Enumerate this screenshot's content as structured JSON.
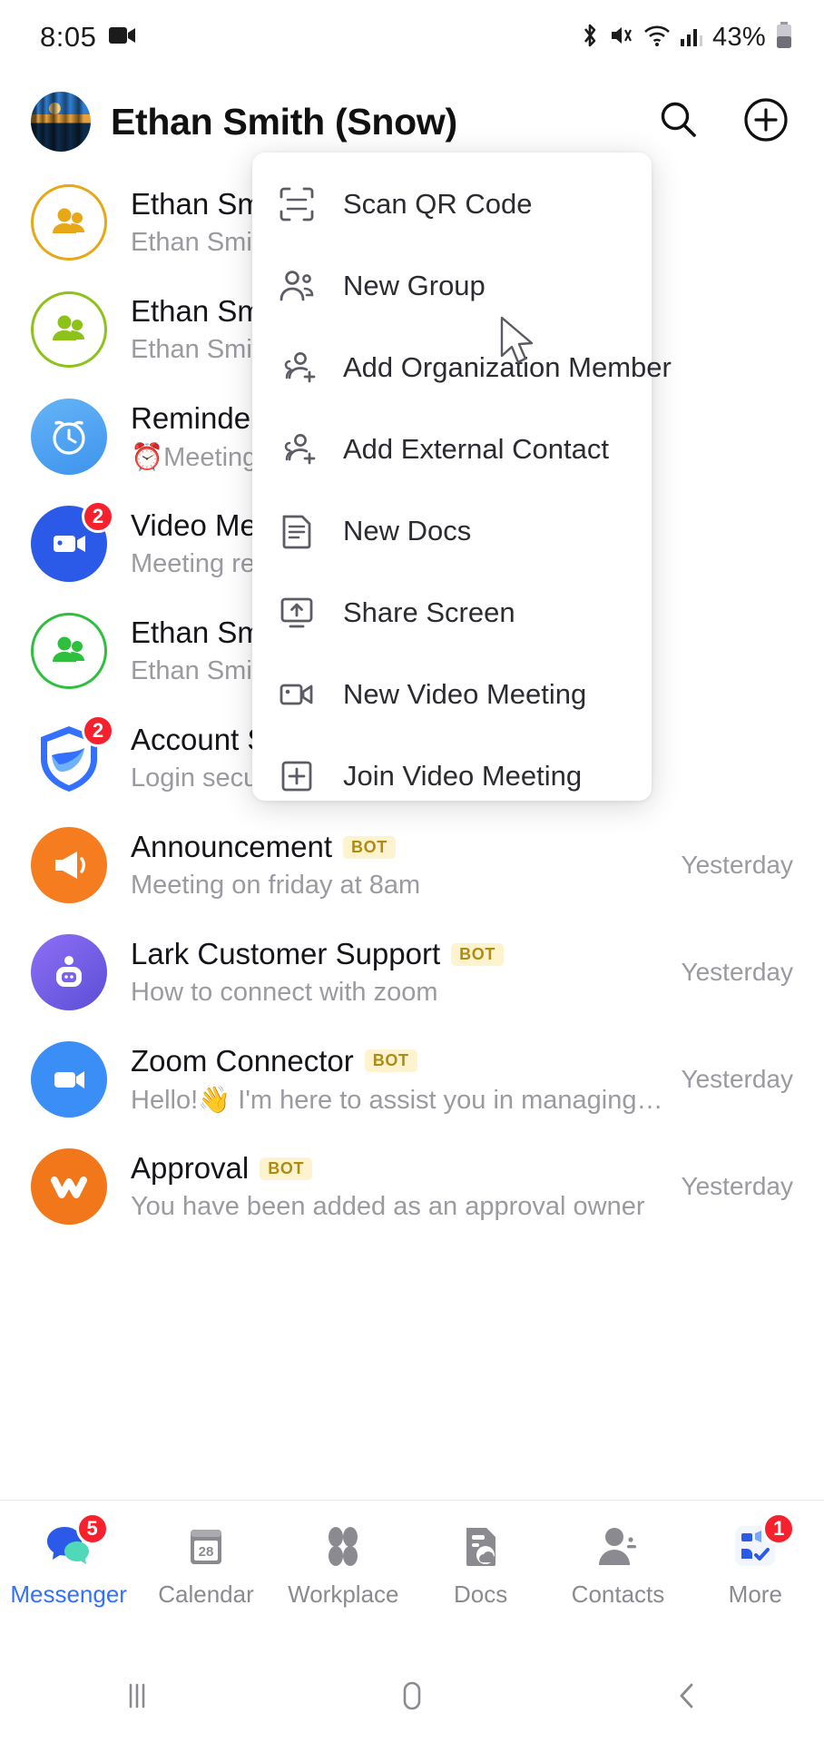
{
  "status_bar": {
    "time": "8:05",
    "battery_percent": "43%",
    "icons": [
      "video-recording-icon",
      "bluetooth-icon",
      "mute-icon",
      "wifi-icon",
      "cellular-signal-icon",
      "battery-icon"
    ]
  },
  "header": {
    "title": "Ethan Smith (Snow)",
    "avatar_name": "user-avatar",
    "search_label": "Search",
    "add_label": "Add"
  },
  "menu": {
    "items": [
      {
        "label": "Scan QR Code",
        "icon": "scan-qr-icon"
      },
      {
        "label": "New Group",
        "icon": "new-group-icon"
      },
      {
        "label": "Add Organization Member",
        "icon": "add-organization-member-icon"
      },
      {
        "label": "Add External Contact",
        "icon": "add-external-contact-icon"
      },
      {
        "label": "New Docs",
        "icon": "new-docs-icon"
      },
      {
        "label": "Share Screen",
        "icon": "share-screen-icon"
      },
      {
        "label": "New Video Meeting",
        "icon": "new-video-meeting-icon"
      },
      {
        "label": "Join Video Meeting",
        "icon": "join-video-meeting-icon"
      }
    ]
  },
  "chats": [
    {
      "title": "Ethan Smith",
      "subtitle": "Ethan Smith",
      "time": "",
      "bot": false,
      "badge": "",
      "avatar": "group-avatar-yellow",
      "avatar_style": "ring",
      "color": "#e6a817"
    },
    {
      "title": "Ethan Smith",
      "subtitle": "Ethan Smith",
      "time": "",
      "bot": false,
      "badge": "",
      "avatar": "group-avatar-lime",
      "avatar_style": "ring",
      "color": "#8cc219"
    },
    {
      "title": "Reminder",
      "subtitle": "⏰Meeting R",
      "time": "",
      "bot": false,
      "badge": "",
      "avatar": "reminder-clock-avatar",
      "avatar_style": "solid",
      "color": "#54a6f0"
    },
    {
      "title": "Video Meeting",
      "subtitle": "Meeting reco",
      "time": "",
      "bot": false,
      "badge": "2",
      "avatar": "video-meeting-avatar",
      "avatar_style": "solid",
      "color": "#2b59e8"
    },
    {
      "title": "Ethan Smith",
      "subtitle": "Ethan Smith",
      "time": "",
      "bot": false,
      "badge": "",
      "avatar": "group-avatar-green",
      "avatar_style": "ring",
      "color": "#2fbf3f"
    },
    {
      "title": "Account Se",
      "subtitle": "Login securit",
      "time": "",
      "bot": false,
      "badge": "2",
      "avatar": "account-security-shield-avatar",
      "avatar_style": "solid",
      "color": "#3370ff"
    },
    {
      "title": "Announcement",
      "subtitle": "Meeting on friday at 8am",
      "time": "Yesterday",
      "bot": true,
      "badge": "",
      "avatar": "announcement-megaphone-avatar",
      "avatar_style": "solid",
      "color": "#f57c1f"
    },
    {
      "title": "Lark Customer Support",
      "subtitle": "How to connect with zoom",
      "time": "Yesterday",
      "bot": true,
      "badge": "",
      "avatar": "lark-support-bot-avatar",
      "avatar_style": "solid",
      "color": "#7a5cf0"
    },
    {
      "title": "Zoom Connector",
      "subtitle": "Hello!👋 I'm here to assist you in managing your Zo…",
      "time": "Yesterday",
      "bot": true,
      "badge": "",
      "avatar": "zoom-connector-avatar",
      "avatar_style": "solid",
      "color": "#3b8ef5"
    },
    {
      "title": "Approval",
      "subtitle": "You have been added as an approval owner",
      "time": "Yesterday",
      "bot": true,
      "badge": "",
      "avatar": "approval-avatar",
      "avatar_style": "solid",
      "color": "#f2761a"
    }
  ],
  "bot_badge_text": "BOT",
  "bottom_nav": {
    "items": [
      {
        "label": "Messenger",
        "icon": "messenger-icon",
        "badge": "5",
        "active": true
      },
      {
        "label": "Calendar",
        "icon": "calendar-icon",
        "badge": "",
        "active": false,
        "day": "28"
      },
      {
        "label": "Workplace",
        "icon": "workplace-icon",
        "badge": "",
        "active": false
      },
      {
        "label": "Docs",
        "icon": "docs-icon",
        "badge": "",
        "active": false
      },
      {
        "label": "Contacts",
        "icon": "contacts-icon",
        "badge": "",
        "active": false
      },
      {
        "label": "More",
        "icon": "more-apps-icon",
        "badge": "1",
        "active": false
      }
    ]
  },
  "android_nav": {
    "recents_label": "Recents",
    "home_label": "Home",
    "back_label": "Back"
  },
  "colors": {
    "accent": "#3370ff",
    "badge_red": "#f5222d",
    "bot_badge_bg": "#fdf4cf",
    "bot_badge_text": "#b08b14",
    "muted_text": "#9a9aa1"
  }
}
